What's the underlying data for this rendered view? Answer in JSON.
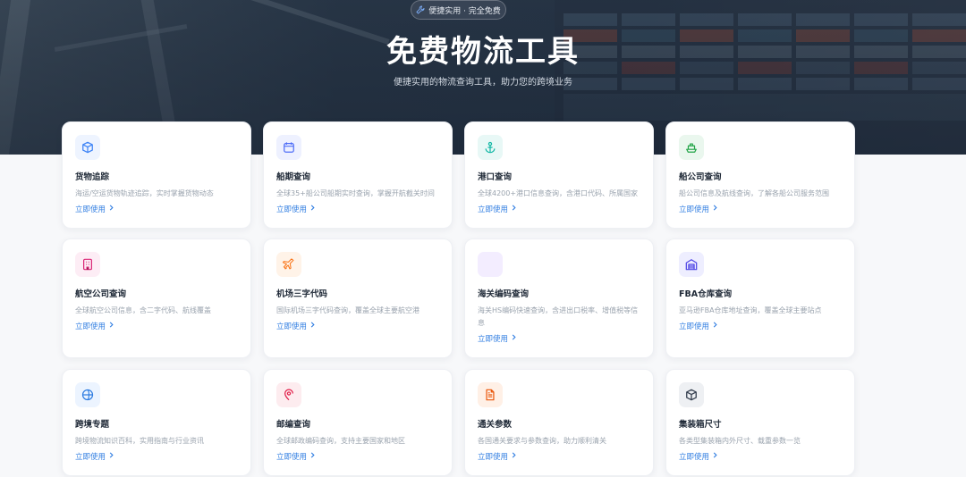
{
  "hero": {
    "badge": "便捷实用 · 完全免费",
    "title": "免费物流工具",
    "subtitle": "便捷实用的物流查询工具，助力您的跨境业务"
  },
  "cards": [
    {
      "title": "货物追踪",
      "desc": "海运/空运货物轨迹追踪，实时掌握货物动态",
      "link": "立即使用",
      "icon": "box-icon",
      "color": "#3b82f6",
      "bg": "#eef4ff"
    },
    {
      "title": "船期查询",
      "desc": "全球35+船公司船期实时查询，掌握开航截关时间",
      "link": "立即使用",
      "icon": "calendar-icon",
      "color": "#4f6ef7",
      "bg": "#eef1ff"
    },
    {
      "title": "港口查询",
      "desc": "全球4200+港口信息查询，含港口代码、所属国家",
      "link": "立即使用",
      "icon": "anchor-icon",
      "color": "#14b8a6",
      "bg": "#e8f8f6"
    },
    {
      "title": "船公司查询",
      "desc": "船公司信息及航线查询，了解各船公司服务范围",
      "link": "立即使用",
      "icon": "ship-icon",
      "color": "#22a447",
      "bg": "#eaf7ee"
    },
    {
      "title": "航空公司查询",
      "desc": "全球航空公司信息，含二字代码、航线覆盖",
      "link": "立即使用",
      "icon": "building-icon",
      "color": "#db2777",
      "bg": "#fdedf5"
    },
    {
      "title": "机场三字代码",
      "desc": "国际机场三字代码查询，覆盖全球主要航空港",
      "link": "立即使用",
      "icon": "plane-icon",
      "color": "#f97316",
      "bg": "#fff3e8"
    },
    {
      "title": "海关编码查询",
      "desc": "海关HS编码快速查询，含进出口税率、增值税等信息",
      "link": "立即使用",
      "icon": "book-icon",
      "color": "#7c3aed",
      "bg": "#f3edff"
    },
    {
      "title": "FBA仓库查询",
      "desc": "亚马逊FBA仓库地址查询，覆盖全球主要站点",
      "link": "立即使用",
      "icon": "warehouse-icon",
      "color": "#4f46e5",
      "bg": "#eeeeff"
    },
    {
      "title": "跨境专题",
      "desc": "跨境物流知识百科，实用指南与行业资讯",
      "link": "立即使用",
      "icon": "globe-icon",
      "color": "#2f7de1",
      "bg": "#ecf4ff"
    },
    {
      "title": "邮编查询",
      "desc": "全球邮政编码查询，支持主要国家和地区",
      "link": "立即使用",
      "icon": "map-pin-icon",
      "color": "#e11d48",
      "bg": "#fdecef"
    },
    {
      "title": "通关参数",
      "desc": "各国通关要求与参数查询，助力顺利清关",
      "link": "立即使用",
      "icon": "document-icon",
      "color": "#ea580c",
      "bg": "#fff0e6"
    },
    {
      "title": "集装箱尺寸",
      "desc": "各类型集装箱内外尺寸、载重参数一览",
      "link": "立即使用",
      "icon": "cube-icon",
      "color": "#374151",
      "bg": "#eef0f3"
    }
  ]
}
